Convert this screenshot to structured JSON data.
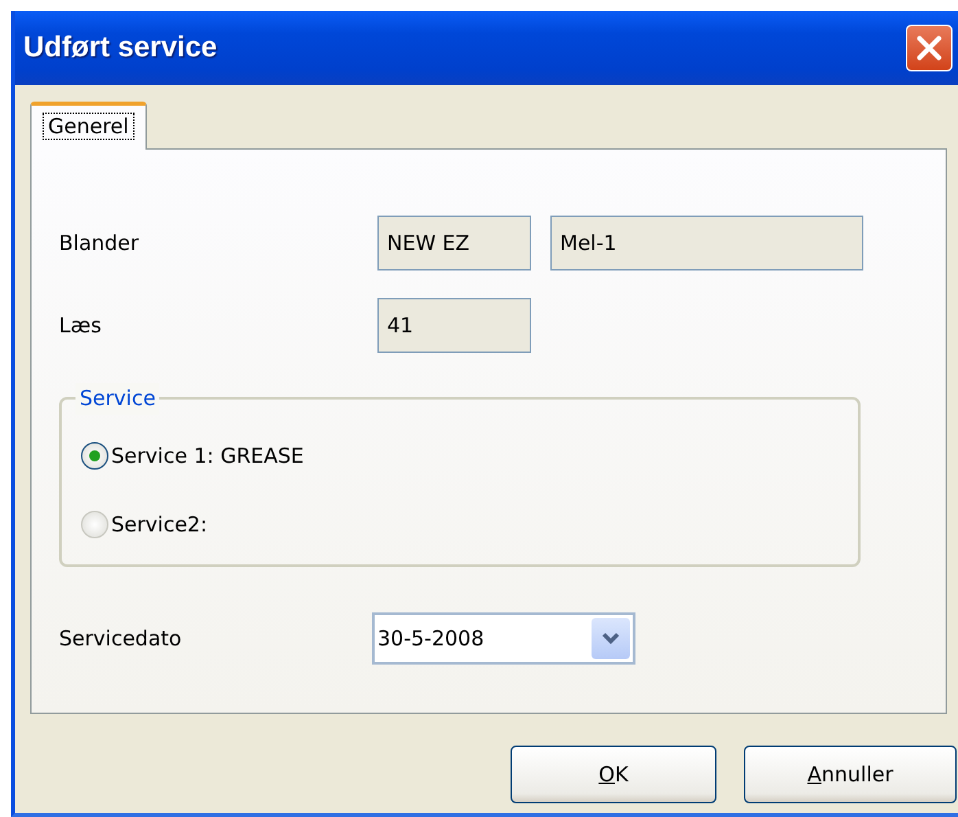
{
  "window": {
    "title": "Udført service"
  },
  "tabs": [
    {
      "label": "Generel",
      "selected": true
    }
  ],
  "fields": [
    {
      "label": "Blander",
      "values": [
        "NEW EZ",
        "Mel-1"
      ]
    },
    {
      "label": "Læs",
      "values": [
        "41"
      ]
    }
  ],
  "service_group": {
    "title": "Service",
    "options": [
      {
        "label": "Service 1: GREASE",
        "selected": true
      },
      {
        "label": "Service2:",
        "selected": false
      }
    ]
  },
  "service_date": {
    "label": "Servicedato",
    "value": "30-5-2008"
  },
  "buttons": [
    "OK",
    "Annuller"
  ]
}
